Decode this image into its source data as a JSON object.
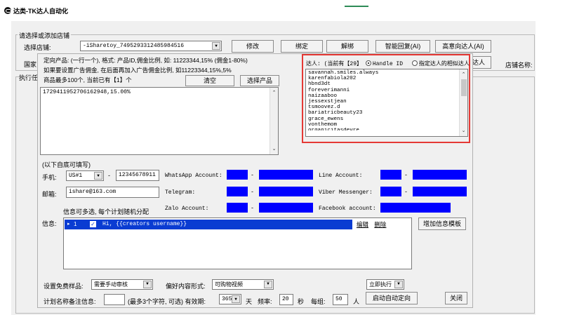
{
  "app": {
    "title": "达类-TK达人自动化"
  },
  "store_group": {
    "legend": "请选择或添加店铺",
    "store_label": "选择店铺:",
    "store_value": "-iSharetoy_7495293312485984516",
    "edit_button": "修改",
    "bind_button": "绑定",
    "unbind_button": "解绑",
    "smart_reply_button": "智能回复(AI)",
    "premium_button": "高意向达人(AI)",
    "country_label": "国家",
    "exec_label": "执行任",
    "find_creator_fragment": "达人",
    "store_name_label": "店铺名称:"
  },
  "product": {
    "intro_line1": "定向产品: (一行一个), 格式: 产品ID,佣金比例, 如: 11223344,15% (佣金1-80%)",
    "intro_line2": "如果要设置广告佣金, 在后面再加入广告佣金比例, 如11223344,15%,5%",
    "limit_text": "商品最多100个, 当前已有【1】个",
    "clear_button": "清空",
    "select_button": "选择产品",
    "entries": [
      "1729411952706162948,15.00%"
    ]
  },
  "creators": {
    "header": "达人: (当前有【29】",
    "radio_handle": "Handle ID",
    "radio_similar": "指定达人的相似达人",
    "handles": [
      "savannah.smiles.always",
      "karenfabiola202",
      "hbnd3dt",
      "foreverimanni",
      "naizaaboo",
      "jessexstjean",
      "tsmoovez.d",
      "bariatricbeauty23",
      "grace_ewens",
      "vonthemom",
      "organicitasdevre"
    ]
  },
  "contact": {
    "section_label": "(以下自底可填写)",
    "phone_label": "手机:",
    "phone_country": "US#1",
    "phone_dash": "-",
    "phone_value": "12345678911",
    "email_label": "邮箱:",
    "email_value": "ishare@163.com",
    "multi_note": "信息可多选, 每个计划随机分配",
    "whatsapp_label": "WhatsApp Account:",
    "telegram_label": "Telegram:",
    "zalo_label": "Zalo Account:",
    "line_label": "Line Account:",
    "viber_label": "Viber Messenger:",
    "facebook_label": "Facebook account:",
    "dash": "-"
  },
  "messages": {
    "label": "信息:",
    "row_index": "1",
    "row_text": "Hi, {{creators username}}",
    "edit_link": "编辑",
    "delete_link": "删除",
    "add_template_button": "增加信息模板"
  },
  "footer": {
    "sample_label": "设置免费样品:",
    "sample_value": "需要手动审核",
    "content_label": "偏好内容形式:",
    "content_value": "可购物视频",
    "execute_value": "立即执行",
    "plan_note_label": "计划名称备注信息:",
    "plan_note_hint": "(最多3个字符, 可选) 有效期:",
    "validity_value": "365",
    "day_unit": "天",
    "freq_label": "频率:",
    "freq_value": "20",
    "second_unit": "秒",
    "group_label": "每组:",
    "group_value": "50",
    "person_unit": "人",
    "start_button": "启动自动定向",
    "close_button": "关闭"
  },
  "icons": {
    "dropdown": "chevron-down-icon",
    "scroll_up": "chevron-up-icon",
    "expand": "expand-arrow-icon",
    "check": "checkbox-checked-icon"
  },
  "colors": {
    "highlight_border": "#e53935",
    "placeholder_blue": "#0000ff",
    "selected_row": "#0a3cd2"
  }
}
